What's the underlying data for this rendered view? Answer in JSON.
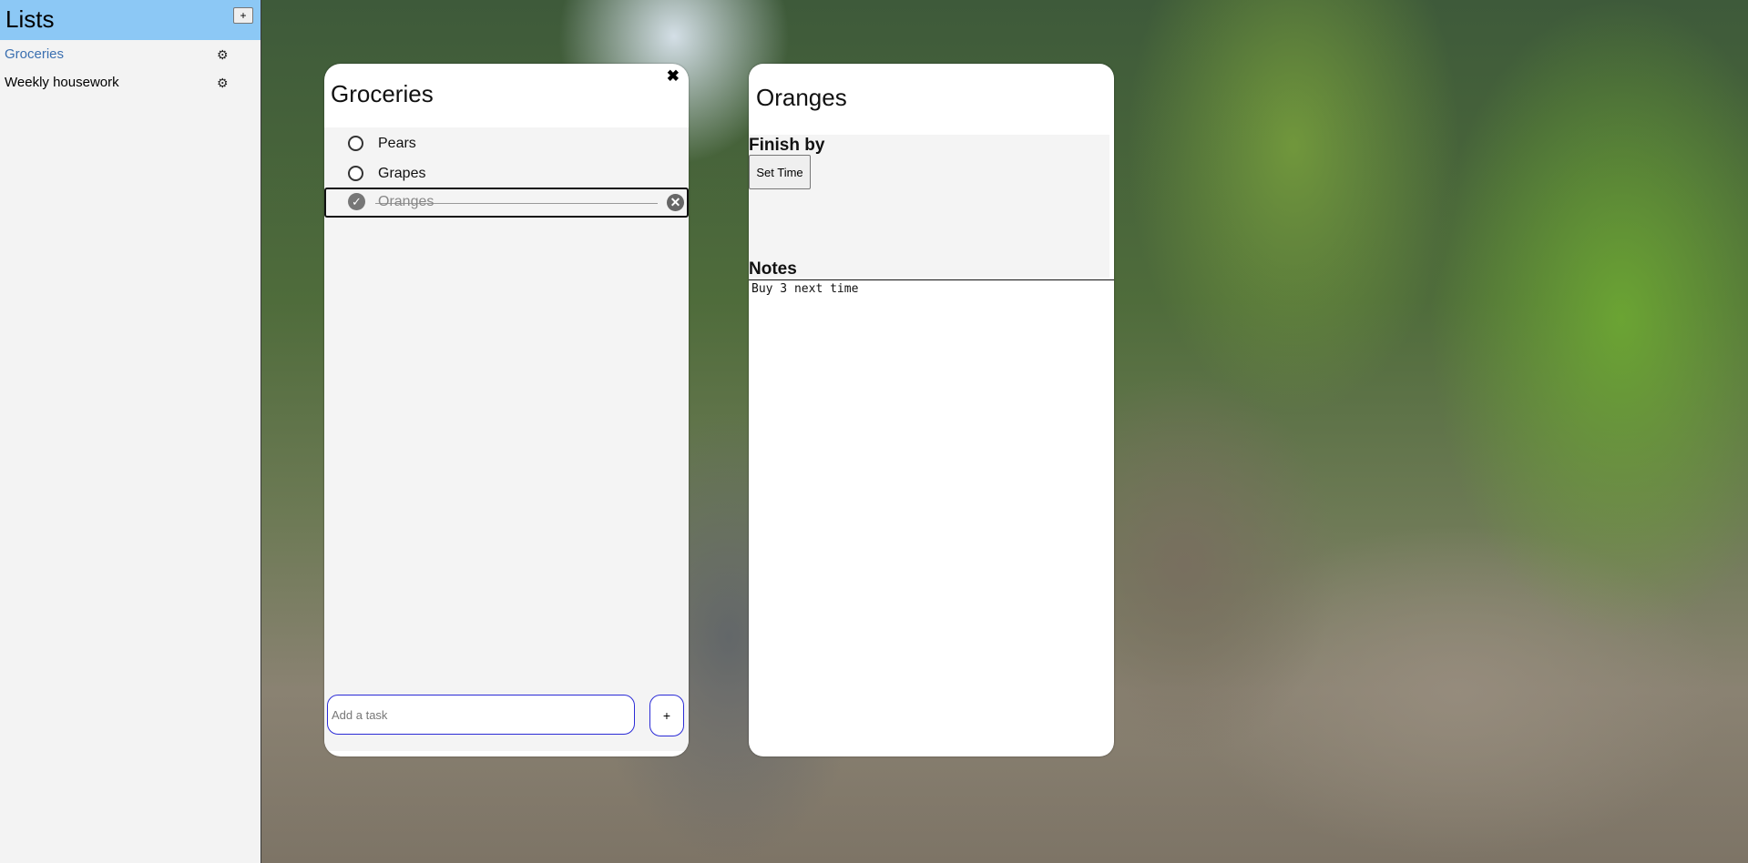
{
  "sidebar": {
    "title": "Lists",
    "add_button_label": "+",
    "items": [
      {
        "label": "Groceries",
        "settings_icon": "⚙"
      },
      {
        "label": "Weekly housework",
        "settings_icon": "⚙"
      }
    ],
    "header_color": "#8cc8f5",
    "active_color": "#3a6fb0"
  },
  "list_panel": {
    "title": "Groceries",
    "close_icon": "✖",
    "tasks": [
      {
        "name": "Pears",
        "done": false
      },
      {
        "name": "Grapes",
        "done": false
      },
      {
        "name": "Oranges",
        "done": true
      }
    ],
    "check_icon": "✓",
    "delete_icon": "✕",
    "add_task_placeholder": "Add a task",
    "add_task_button_label": "+"
  },
  "detail_panel": {
    "title": "Oranges",
    "finish_by_label": "Finish by",
    "set_time_button_label": "Set Time",
    "notes_label": "Notes",
    "notes_text": "Buy 3 next time"
  }
}
